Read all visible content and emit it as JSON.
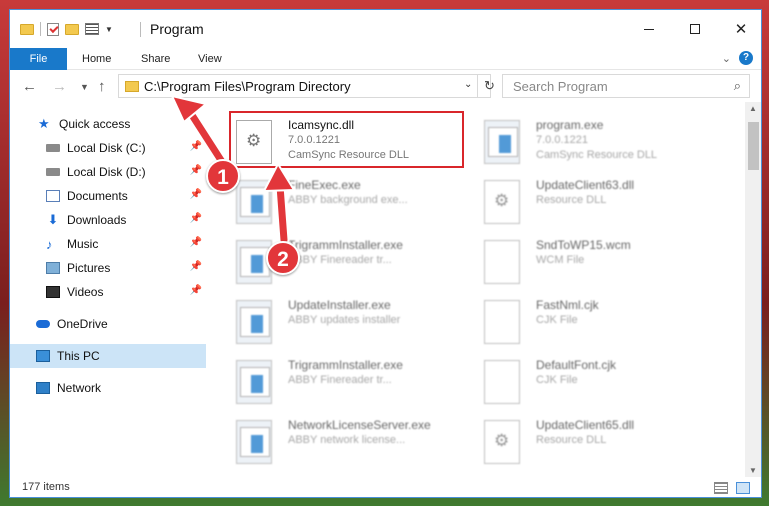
{
  "window": {
    "title": "Program",
    "minimize": "—",
    "maximize": "☐",
    "close": "✕"
  },
  "ribbon": {
    "tabs": [
      {
        "label": "File"
      },
      {
        "label": "Home"
      },
      {
        "label": "Share"
      },
      {
        "label": "View"
      }
    ],
    "help": "?"
  },
  "address": {
    "path": "C:\\Program Files\\Program Directory",
    "search_placeholder": "Search Program"
  },
  "nav": {
    "items": [
      {
        "label": "Quick access"
      },
      {
        "label": "Local Disk (C:)"
      },
      {
        "label": "Local Disk (D:)"
      },
      {
        "label": "Documents"
      },
      {
        "label": "Downloads"
      },
      {
        "label": "Music"
      },
      {
        "label": "Pictures"
      },
      {
        "label": "Videos"
      },
      {
        "label": "OneDrive"
      },
      {
        "label": "This PC"
      },
      {
        "label": "Network"
      }
    ]
  },
  "files": [
    {
      "name": "Icamsync.dll",
      "line2": "7.0.0.1221",
      "line3": "CamSync Resource DLL",
      "icon": "dll-gear-icon"
    },
    {
      "name": "program.exe",
      "line2": "7.0.0.1221",
      "line3": "CamSync Resource DLL",
      "icon": "exe-icon"
    },
    {
      "name": "FineExec.exe",
      "line2": "ABBY background exe...",
      "icon": "exe-icon"
    },
    {
      "name": "UpdateClient63.dll",
      "line2": "Resource DLL",
      "icon": "dll-gear-icon"
    },
    {
      "name": "TrigrammInstaller.exe",
      "line2": "ABBY Finereader tr...",
      "icon": "exe-icon"
    },
    {
      "name": "SndToWP15.wcm",
      "line2": "WCM File",
      "icon": "document-icon"
    },
    {
      "name": "UpdateInstaller.exe",
      "line2": "ABBY updates installer",
      "icon": "exe-icon"
    },
    {
      "name": "FastNml.cjk",
      "line2": "CJK File",
      "icon": "document-icon"
    },
    {
      "name": "TrigrammInstaller.exe",
      "line2": "ABBY Finereader tr...",
      "icon": "exe-icon"
    },
    {
      "name": "DefaultFont.cjk",
      "line2": "CJK File",
      "icon": "document-icon"
    },
    {
      "name": "NetworkLicenseServer.exe",
      "line2": "ABBY network license...",
      "icon": "exe-icon"
    },
    {
      "name": "UpdateClient65.dll",
      "line2": "Resource DLL",
      "icon": "dll-gear-icon"
    }
  ],
  "status": {
    "item_count": "177 items"
  },
  "annotations": {
    "step1": "1",
    "step2": "2",
    "color": "#e2363a"
  }
}
